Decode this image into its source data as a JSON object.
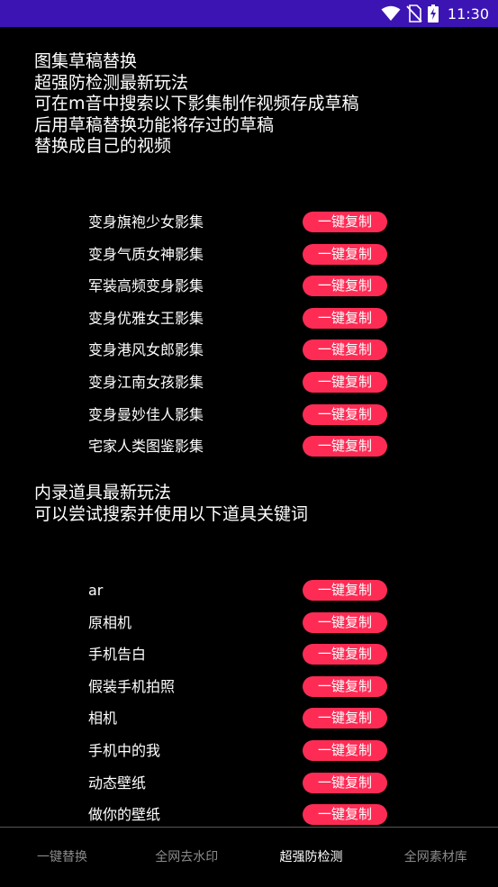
{
  "status_bar": {
    "time": "11:30",
    "icons": [
      "wifi-icon",
      "no-sim-icon",
      "battery-charging-icon"
    ],
    "bg_color": "#3c14b4"
  },
  "intro": {
    "lines": [
      "图集草稿替换",
      "超强防检测最新玩法",
      "可在m音中搜索以下影集制作视频存成草稿",
      "后用草稿替换功能将存过的草稿",
      "替换成自己的视频"
    ]
  },
  "album_list": [
    {
      "label": "变身旗袍少女影集",
      "button": "一键复制"
    },
    {
      "label": "变身气质女神影集",
      "button": "一键复制"
    },
    {
      "label": "军装高频变身影集",
      "button": "一键复制"
    },
    {
      "label": "变身优雅女王影集",
      "button": "一键复制"
    },
    {
      "label": "变身港风女郎影集",
      "button": "一键复制"
    },
    {
      "label": "变身江南女孩影集",
      "button": "一键复制"
    },
    {
      "label": "变身曼妙佳人影集",
      "button": "一键复制"
    },
    {
      "label": "宅家人类图鉴影集",
      "button": "一键复制"
    }
  ],
  "intro2": {
    "lines": [
      "内录道具最新玩法",
      "可以尝试搜索并使用以下道具关键词"
    ]
  },
  "prop_list": [
    {
      "label": "ar",
      "button": "一键复制"
    },
    {
      "label": "原相机",
      "button": "一键复制"
    },
    {
      "label": "手机告白",
      "button": "一键复制"
    },
    {
      "label": "假装手机拍照",
      "button": "一键复制"
    },
    {
      "label": "相机",
      "button": "一键复制"
    },
    {
      "label": "手机中的我",
      "button": "一键复制"
    },
    {
      "label": "动态壁纸",
      "button": "一键复制"
    },
    {
      "label": "做你的壁纸",
      "button": "一键复制"
    }
  ],
  "tabs": [
    {
      "label": "一键替换",
      "active": false
    },
    {
      "label": "全网去水印",
      "active": false
    },
    {
      "label": "超强防检测",
      "active": true
    },
    {
      "label": "全网素材库",
      "active": false
    }
  ],
  "colors": {
    "accent": "#fe2c55",
    "background": "#000000",
    "tab_inactive": "#8a8a8a"
  }
}
